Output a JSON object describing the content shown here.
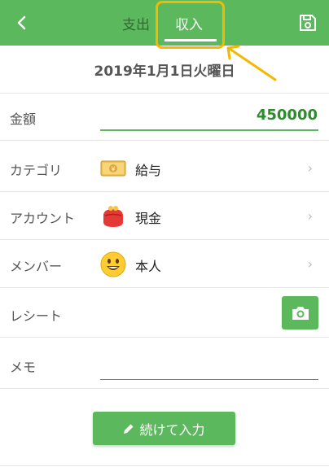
{
  "header": {
    "tabs": [
      {
        "label": "支出",
        "active": false
      },
      {
        "label": "収入",
        "active": true
      }
    ],
    "icons": {
      "back": "chevron-left-icon",
      "save": "floppy-disk-icon"
    },
    "accent": "#5cb85c",
    "highlight_color": "#f5b800"
  },
  "date": "2019年1月1日火曜日",
  "form": {
    "amount": {
      "label": "金額",
      "value": "450000"
    },
    "category": {
      "label": "カテゴリ",
      "icon": "yen-banknote-icon",
      "value": "給与"
    },
    "account": {
      "label": "アカウント",
      "icon": "red-purse-icon",
      "value": "現金"
    },
    "member": {
      "label": "メンバー",
      "icon": "smiley-face-icon",
      "value": "本人"
    },
    "receipt": {
      "label": "レシート",
      "icon": "camera-icon"
    },
    "memo": {
      "label": "メモ",
      "value": ""
    }
  },
  "chevron": "›",
  "continue_button": {
    "label": "続けて入力",
    "icon": "pencil-icon"
  }
}
